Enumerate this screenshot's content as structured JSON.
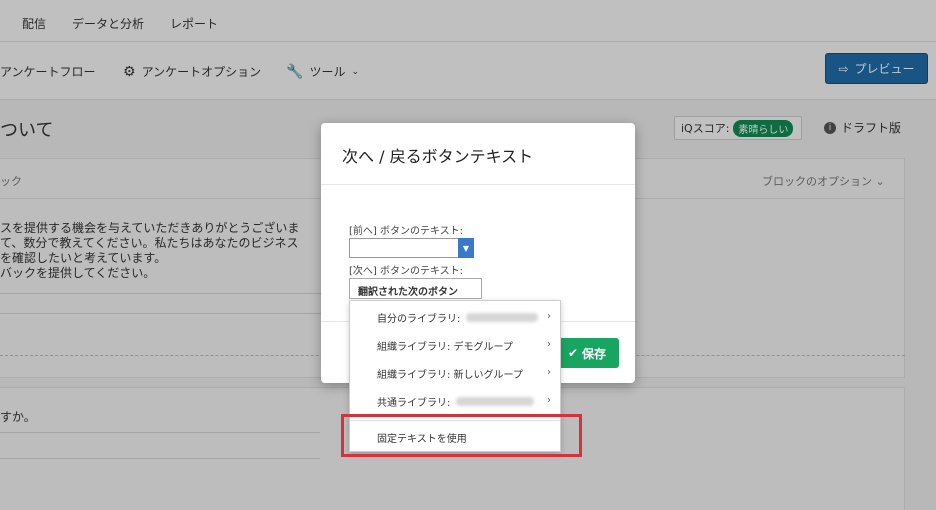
{
  "nav": {
    "items": [
      "配信",
      "データと分析",
      "レポート"
    ]
  },
  "toolbar": {
    "flow": "アンケートフロー",
    "options": "アンケートオプション",
    "tools": "ツール",
    "preview": "プレビュー"
  },
  "page": {
    "title": "ついて",
    "iq_label": "iQスコア:",
    "iq_value": "素晴らしい",
    "draft": "ドラフト版"
  },
  "block": {
    "name": "ック",
    "options": "ブロックのオプション",
    "question_text": "スを提供する機会を与えていただきありがとうございま\nて、数分で教えてください。私たちはあなたのビジネス\nを確認したいと考えています。\nバックを提供してください。",
    "question2": "すか。"
  },
  "modal": {
    "title": "次へ / 戻るボタンテキスト",
    "prev_label": "[前へ] ボタンのテキスト:",
    "prev_value": "",
    "next_label": "[次へ] ボタンのテキスト:",
    "next_value": "翻訳された次のボタン",
    "save": "保存"
  },
  "menu": {
    "items": [
      {
        "label": "自分のライブラリ:",
        "has_sub": true,
        "chevron": "›"
      },
      {
        "label": "組織ライブラリ: デモグループ",
        "has_sub": true,
        "chevron": "›"
      },
      {
        "label": "組織ライブラリ: 新しいグループ",
        "has_sub": true,
        "chevron": "›"
      },
      {
        "label": "共通ライブラリ:",
        "has_sub": true,
        "chevron": "›"
      }
    ],
    "fixed_text": "固定テキストを使用"
  },
  "colors": {
    "preview_button": "#1f6ca9",
    "save_button": "#17a561",
    "iq_badge": "#138c52",
    "highlight": "#d3333b",
    "select_arrow": "#3a78c9"
  }
}
